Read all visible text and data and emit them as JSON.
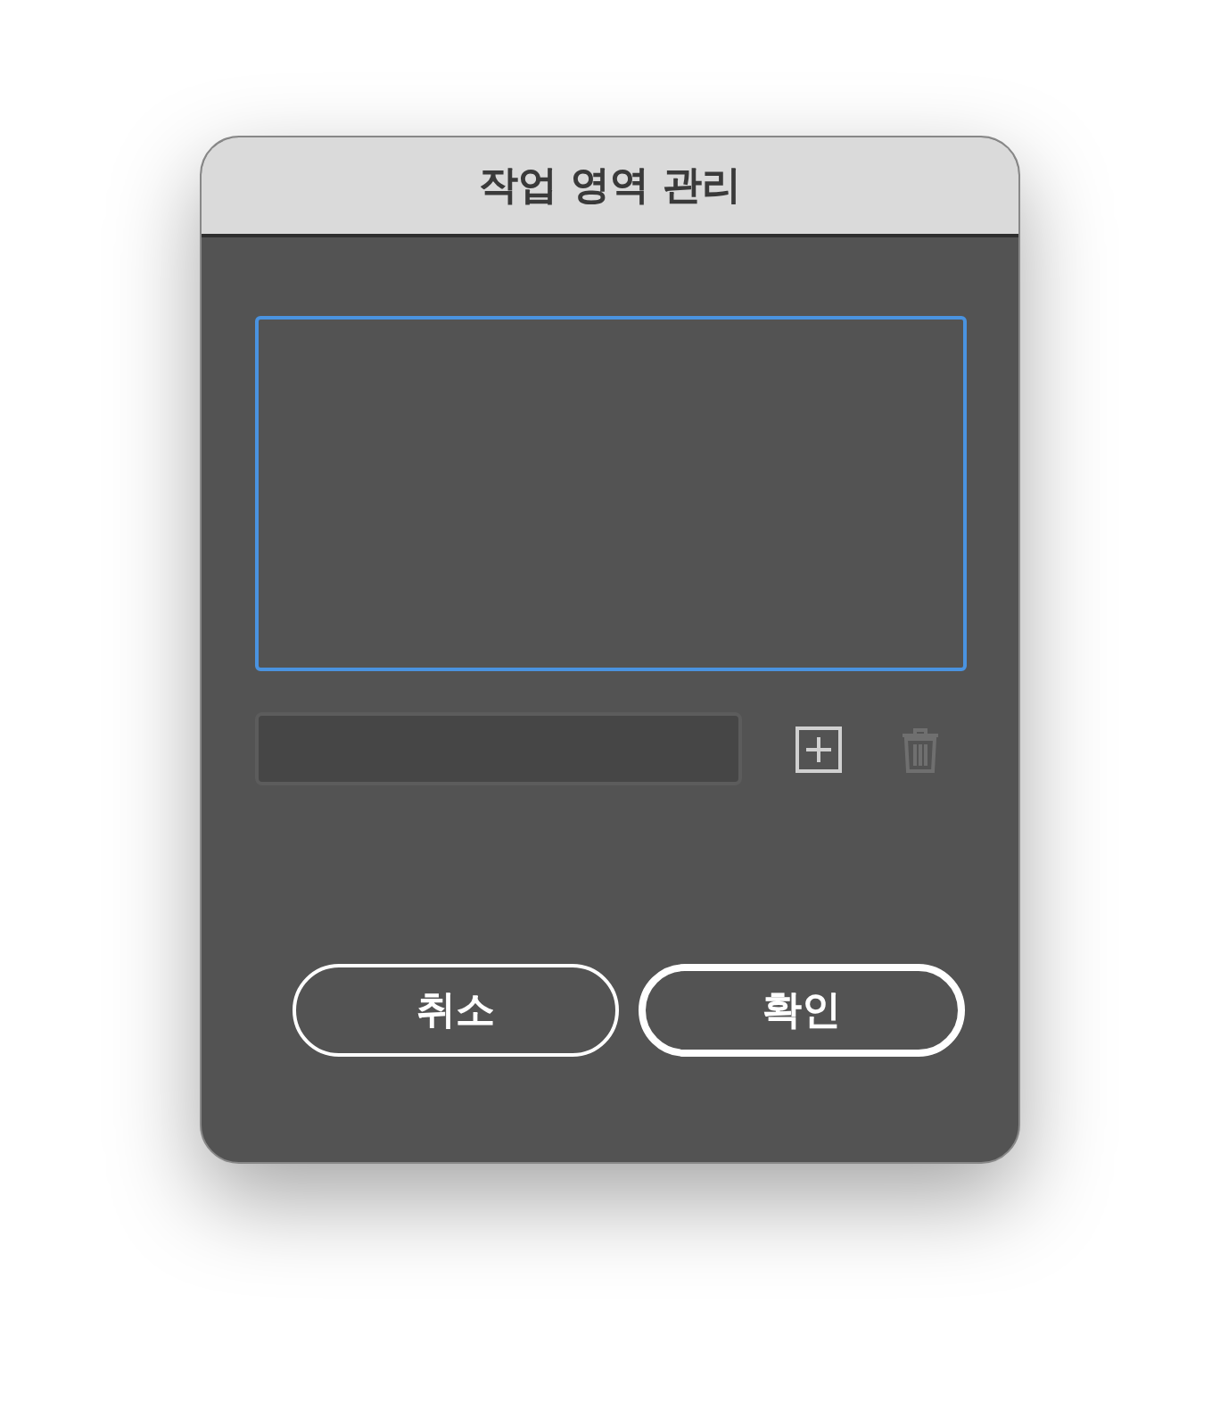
{
  "window": {
    "title": "작업 영역 관리"
  },
  "list": {
    "focused": true
  },
  "tools": [
    {
      "kind": "add",
      "disabled": false
    },
    {
      "kind": "delete",
      "disabled": true
    }
  ],
  "buttons": [
    {
      "label": "취소",
      "default": false
    },
    {
      "label": "확인",
      "default": true
    }
  ]
}
